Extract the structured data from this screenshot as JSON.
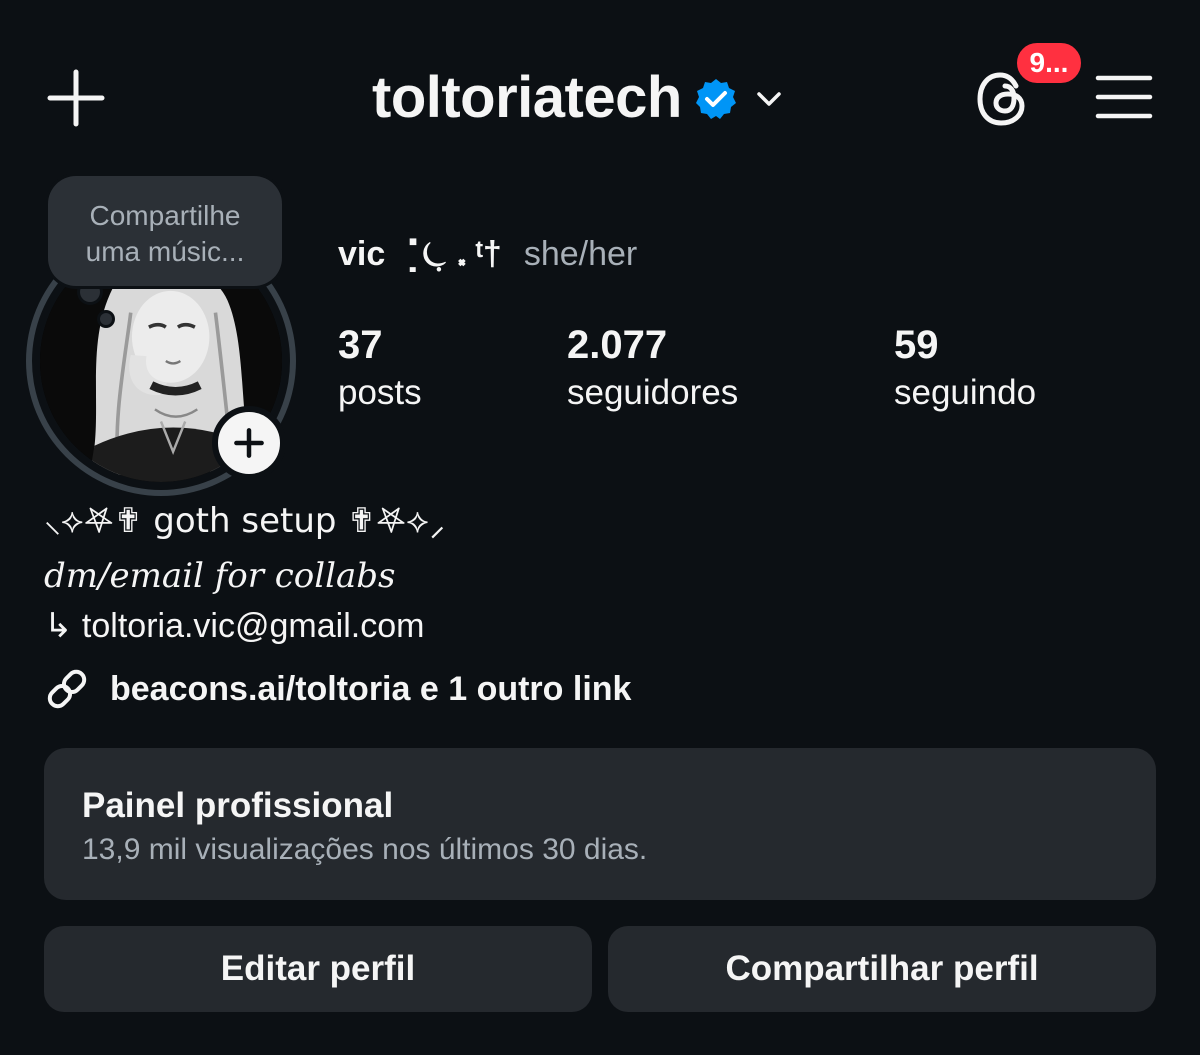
{
  "header": {
    "username": "toltoriatech",
    "notification_count": "9...",
    "icons": {
      "create": "plus-icon",
      "verified": "verified-badge-icon",
      "switch_account": "chevron-down-icon",
      "threads": "threads-icon",
      "menu": "hamburger-menu-icon"
    },
    "verified_color": "#0095f6",
    "badge_color": "#ff3040"
  },
  "profile": {
    "note": "Compartilhe uma músic...",
    "display_name": "vic ⠈̣⏾̣ ⸼ ᵗ†",
    "pronouns": "she/her",
    "stats": [
      {
        "value": "37",
        "label": "posts"
      },
      {
        "value": "2.077",
        "label": "seguidores"
      },
      {
        "value": "59",
        "label": "seguindo"
      }
    ]
  },
  "bio": {
    "line1": "⸜⟡𖤐✟ goth setup ✟𖤐⟡⸝",
    "line2": "dm/email for collabs",
    "line3": "↳ toltoria.vic@gmail.com",
    "link": "beacons.ai/toltoria e 1 outro link"
  },
  "professional_dashboard": {
    "title": "Painel profissional",
    "subtitle": "13,9 mil visualizações nos últimos 30 dias."
  },
  "actions": {
    "edit": "Editar perfil",
    "share": "Compartilhar perfil"
  },
  "colors": {
    "background": "#0c1014",
    "card": "#25292e",
    "secondary_text": "#a8b0b8"
  }
}
